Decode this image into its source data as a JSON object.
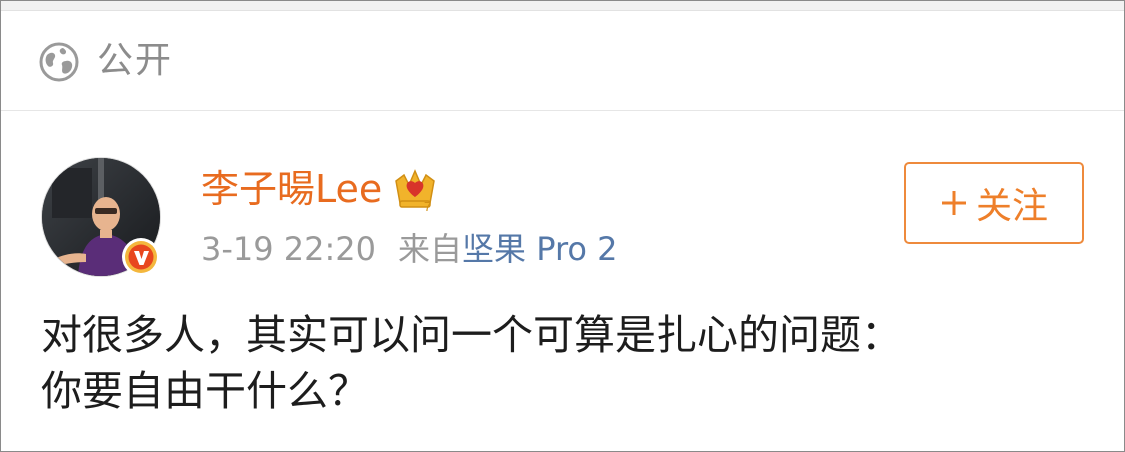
{
  "visibility": {
    "icon": "globe-icon",
    "label": "公开"
  },
  "post": {
    "author": {
      "name": "李子暘Lee",
      "avatar": "avatar",
      "verified_badge": "verified-v-icon",
      "vip_badge": "crown-icon",
      "name_color": "#e86b1f"
    },
    "time": "3-19 22:20",
    "source_prefix": "来自",
    "source_device": "坚果 Pro 2",
    "follow_button": {
      "icon": "plus-icon",
      "label": "关注",
      "color": "#ee7f2a"
    },
    "text": "对很多人，其实可以问一个可算是扎心的问题：\n你要自由干什么？"
  }
}
